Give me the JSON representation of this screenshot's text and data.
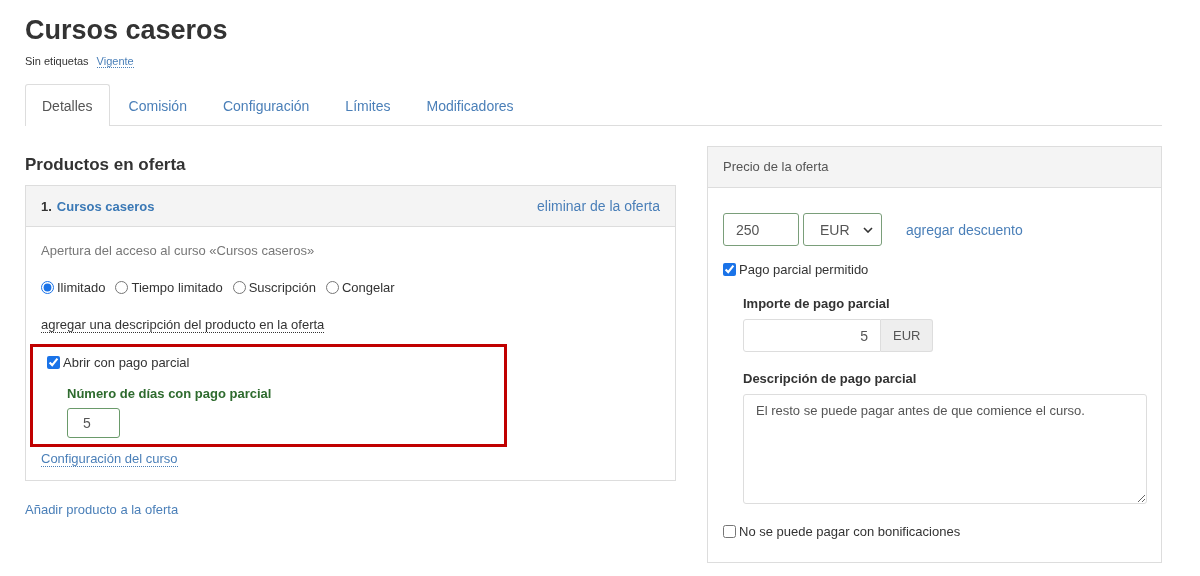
{
  "page": {
    "title": "Cursos caseros",
    "tags_label": "Sin etiquetas",
    "status_link": "Vigente"
  },
  "tabs": [
    {
      "label": "Detalles",
      "selected": true
    },
    {
      "label": "Comisión",
      "selected": false
    },
    {
      "label": "Configuración",
      "selected": false
    },
    {
      "label": "Límites",
      "selected": false
    },
    {
      "label": "Modificadores",
      "selected": false
    }
  ],
  "products": {
    "heading": "Productos en oferta",
    "item": {
      "number": "1.",
      "name": "Cursos caseros",
      "remove_link": "eliminar de la oferta",
      "access_text": "Apertura del acceso al curso «Cursos caseros»",
      "access_options": [
        {
          "label": "Ilimitado",
          "selected": true
        },
        {
          "label": "Tiempo limitado",
          "selected": false
        },
        {
          "label": "Suscripción",
          "selected": false
        },
        {
          "label": "Congelar",
          "selected": false
        }
      ],
      "description_link": "agregar una descripción del producto en la oferta",
      "partial_open": {
        "label": "Abrir con pago parcial",
        "checked": true,
        "highlighted": true
      },
      "days_label": "Número de días con pago parcial",
      "days_value": "5",
      "settings_link": "Configuración del curso"
    },
    "add_link": "Añadir producto a la oferta"
  },
  "price": {
    "heading": "Precio de la oferta",
    "amount": "250",
    "currency": "EUR",
    "discount_link": "agregar descuento",
    "partial_allowed": {
      "label": "Pago parcial permitido",
      "checked": true
    },
    "partial_amount_label": "Importe de pago parcial",
    "partial_amount": "5",
    "partial_currency": "EUR",
    "partial_description_label": "Descripción de pago parcial",
    "partial_description": "El resto se puede pagar antes de que comience el curso.",
    "no_bonus": {
      "label": "No se puede pagar con bonificaciones",
      "checked": false
    }
  }
}
